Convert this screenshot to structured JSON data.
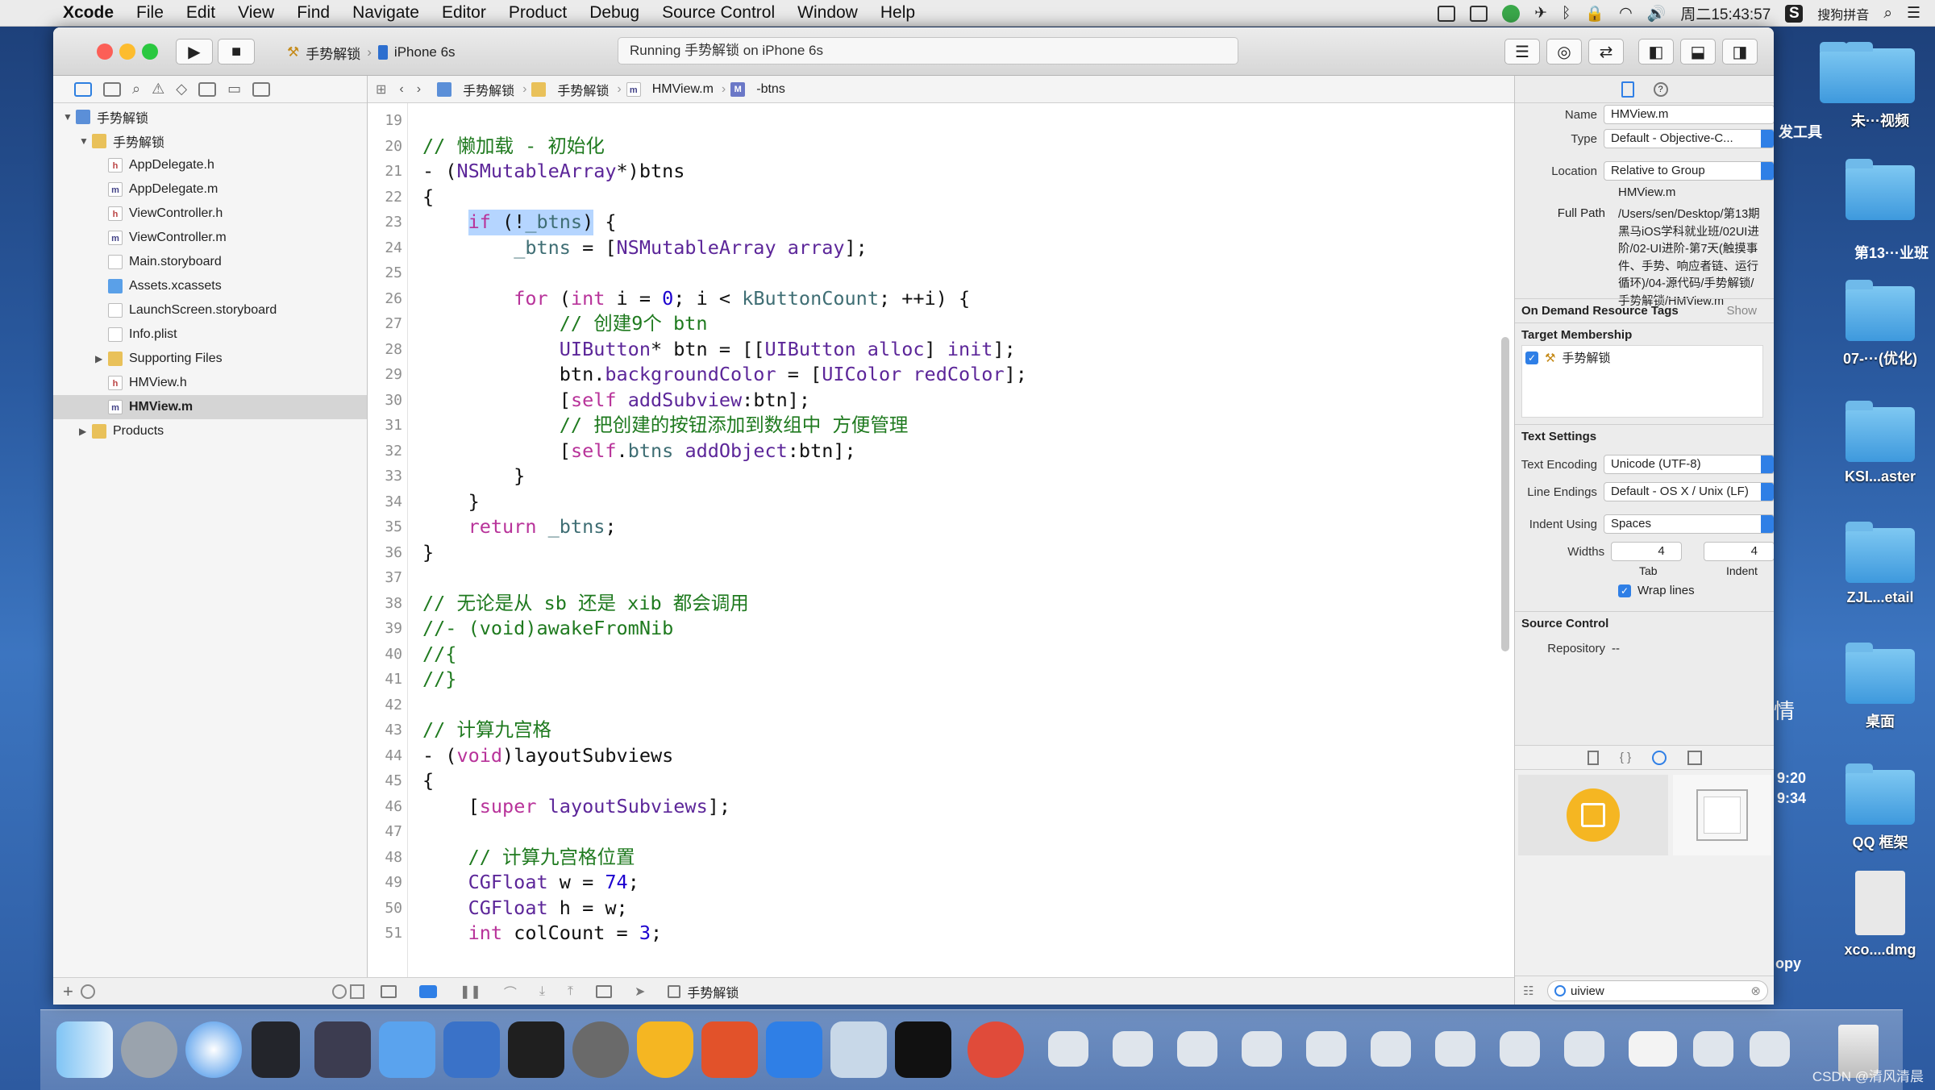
{
  "menubar": {
    "items": [
      "Xcode",
      "File",
      "Edit",
      "View",
      "Find",
      "Navigate",
      "Editor",
      "Product",
      "Debug",
      "Source Control",
      "Window",
      "Help"
    ],
    "clock": "周二15:43:57",
    "ime": "搜狗拼音"
  },
  "desktop": {
    "items": [
      "发工具",
      "未···视频",
      "第13···业班",
      "07-···(优化)",
      "KSI...aster",
      "ZJL...etail",
      "桌面",
      "QQ 框架",
      "xco....dmg"
    ],
    "side_texts": [
      "情",
      "9:20",
      "9:34",
      "opy"
    ]
  },
  "toolbar": {
    "scheme": "手势解锁",
    "device": "iPhone 6s",
    "activity": "Running 手势解锁 on iPhone 6s"
  },
  "jumpbar": {
    "items": [
      "手势解锁",
      "手势解锁",
      "HMView.m",
      "-btns"
    ]
  },
  "navigator": {
    "items": [
      {
        "label": "手势解锁",
        "icon": "project",
        "level": 0,
        "disc": "▼"
      },
      {
        "label": "手势解锁",
        "icon": "group",
        "level": 1,
        "disc": "▼"
      },
      {
        "label": "AppDelegate.h",
        "icon": "h",
        "level": 2,
        "disc": ""
      },
      {
        "label": "AppDelegate.m",
        "icon": "m",
        "level": 2,
        "disc": ""
      },
      {
        "label": "ViewController.h",
        "icon": "h",
        "level": 2,
        "disc": ""
      },
      {
        "label": "ViewController.m",
        "icon": "m",
        "level": 2,
        "disc": ""
      },
      {
        "label": "Main.storyboard",
        "icon": "sb",
        "level": 2,
        "disc": ""
      },
      {
        "label": "Assets.xcassets",
        "icon": "as",
        "level": 2,
        "disc": ""
      },
      {
        "label": "LaunchScreen.storyboard",
        "icon": "sb",
        "level": 2,
        "disc": ""
      },
      {
        "label": "Info.plist",
        "icon": "pl",
        "level": 2,
        "disc": ""
      },
      {
        "label": "Supporting Files",
        "icon": "group",
        "level": 2,
        "disc": "▶"
      },
      {
        "label": "HMView.h",
        "icon": "h",
        "level": 2,
        "disc": ""
      },
      {
        "label": "HMView.m",
        "icon": "m",
        "level": 2,
        "disc": "",
        "selected": true
      },
      {
        "label": "Products",
        "icon": "group",
        "level": 1,
        "disc": "▶"
      }
    ]
  },
  "editor": {
    "lines": [
      {
        "n": "19",
        "t": [
          [
            "",
            ""
          ]
        ]
      },
      {
        "n": "20",
        "t": [
          [
            "c",
            "// 懒加载 - 初始化"
          ]
        ]
      },
      {
        "n": "21",
        "t": [
          [
            "",
            "- ("
          ],
          [
            "t",
            "NSMutableArray"
          ],
          [
            "",
            "*)btns"
          ]
        ]
      },
      {
        "n": "22",
        "t": [
          [
            "",
            "{"
          ]
        ]
      },
      {
        "n": "23",
        "t": [
          [
            "",
            "    "
          ],
          [
            "hlk",
            "if"
          ],
          [
            "hl",
            " (!"
          ],
          [
            "hlp",
            "_btns"
          ],
          [
            "hl",
            ")"
          ],
          [
            "",
            " {"
          ]
        ]
      },
      {
        "n": "24",
        "t": [
          [
            "",
            "        "
          ],
          [
            "p",
            "_btns"
          ],
          [
            "",
            " = ["
          ],
          [
            "t",
            "NSMutableArray"
          ],
          [
            "",
            " "
          ],
          [
            "t",
            "array"
          ],
          [
            "",
            "];"
          ]
        ]
      },
      {
        "n": "25",
        "t": [
          [
            "",
            ""
          ]
        ]
      },
      {
        "n": "26",
        "t": [
          [
            "",
            "        "
          ],
          [
            "k",
            "for"
          ],
          [
            "",
            " ("
          ],
          [
            "k",
            "int"
          ],
          [
            "",
            " i = "
          ],
          [
            "n",
            "0"
          ],
          [
            "",
            "; i < "
          ],
          [
            "p",
            "kButtonCount"
          ],
          [
            "",
            "; ++i) {"
          ]
        ]
      },
      {
        "n": "27",
        "t": [
          [
            "c",
            "            // 创建9个 btn"
          ]
        ]
      },
      {
        "n": "28",
        "t": [
          [
            "",
            "            "
          ],
          [
            "t",
            "UIButton"
          ],
          [
            "",
            "* btn = [["
          ],
          [
            "t",
            "UIButton"
          ],
          [
            "",
            " "
          ],
          [
            "t",
            "alloc"
          ],
          [
            "",
            "] "
          ],
          [
            "t",
            "init"
          ],
          [
            "",
            "];"
          ]
        ]
      },
      {
        "n": "29",
        "t": [
          [
            "",
            "            btn."
          ],
          [
            "t",
            "backgroundColor"
          ],
          [
            "",
            " = ["
          ],
          [
            "t",
            "UIColor"
          ],
          [
            "",
            " "
          ],
          [
            "t",
            "redColor"
          ],
          [
            "",
            "];"
          ]
        ]
      },
      {
        "n": "30",
        "t": [
          [
            "",
            "            ["
          ],
          [
            "k",
            "self"
          ],
          [
            "",
            " "
          ],
          [
            "t",
            "addSubview"
          ],
          [
            "",
            ":btn];"
          ]
        ]
      },
      {
        "n": "31",
        "t": [
          [
            "c",
            "            // 把创建的按钮添加到数组中 方便管理"
          ]
        ]
      },
      {
        "n": "32",
        "t": [
          [
            "",
            "            ["
          ],
          [
            "k",
            "self"
          ],
          [
            "",
            "."
          ],
          [
            "p",
            "btns"
          ],
          [
            "",
            " "
          ],
          [
            "t",
            "addObject"
          ],
          [
            "",
            ":btn];"
          ]
        ]
      },
      {
        "n": "33",
        "t": [
          [
            "",
            "        }"
          ]
        ]
      },
      {
        "n": "34",
        "t": [
          [
            "",
            "    }"
          ]
        ]
      },
      {
        "n": "35",
        "t": [
          [
            "",
            "    "
          ],
          [
            "k",
            "return"
          ],
          [
            "",
            " "
          ],
          [
            "p",
            "_btns"
          ],
          [
            "",
            ";"
          ]
        ]
      },
      {
        "n": "36",
        "t": [
          [
            "",
            "}"
          ]
        ]
      },
      {
        "n": "37",
        "t": [
          [
            "",
            ""
          ]
        ]
      },
      {
        "n": "38",
        "t": [
          [
            "c",
            "// 无论是从 sb 还是 xib 都会调用"
          ]
        ]
      },
      {
        "n": "39",
        "t": [
          [
            "c",
            "//- (void)awakeFromNib"
          ]
        ]
      },
      {
        "n": "40",
        "t": [
          [
            "c",
            "//{"
          ]
        ]
      },
      {
        "n": "41",
        "t": [
          [
            "c",
            "//}"
          ]
        ]
      },
      {
        "n": "42",
        "t": [
          [
            "",
            ""
          ]
        ]
      },
      {
        "n": "43",
        "t": [
          [
            "c",
            "// 计算九宫格"
          ]
        ]
      },
      {
        "n": "44",
        "t": [
          [
            "",
            "- ("
          ],
          [
            "k",
            "void"
          ],
          [
            "",
            ")layoutSubviews"
          ]
        ]
      },
      {
        "n": "45",
        "t": [
          [
            "",
            "{"
          ]
        ]
      },
      {
        "n": "46",
        "t": [
          [
            "",
            "    ["
          ],
          [
            "k",
            "super"
          ],
          [
            "",
            " "
          ],
          [
            "t",
            "layoutSubviews"
          ],
          [
            "",
            "];"
          ]
        ]
      },
      {
        "n": "47",
        "t": [
          [
            "",
            ""
          ]
        ]
      },
      {
        "n": "48",
        "t": [
          [
            "c",
            "    // 计算九宫格位置"
          ]
        ]
      },
      {
        "n": "49",
        "t": [
          [
            "",
            "    "
          ],
          [
            "t",
            "CGFloat"
          ],
          [
            "",
            " w = "
          ],
          [
            "n",
            "74"
          ],
          [
            "",
            ";"
          ]
        ]
      },
      {
        "n": "50",
        "t": [
          [
            "",
            "    "
          ],
          [
            "t",
            "CGFloat"
          ],
          [
            "",
            " h = w;"
          ]
        ]
      },
      {
        "n": "51",
        "t": [
          [
            "",
            "    "
          ],
          [
            "k",
            "int"
          ],
          [
            "",
            " colCount = "
          ],
          [
            "n",
            "3"
          ],
          [
            "",
            ";"
          ]
        ]
      }
    ]
  },
  "debugbar": {
    "target": "手势解锁"
  },
  "inspector": {
    "name_label": "Name",
    "name_value": "HMView.m",
    "type_label": "Type",
    "type_value": "Default - Objective-C...",
    "location_label": "Location",
    "location_value": "Relative to Group",
    "location_file": "HMView.m",
    "fullpath_label": "Full Path",
    "fullpath_value": "/Users/sen/Desktop/第13期黑马iOS学科就业班/02UI进阶/02-UI进阶-第7天(触摸事件、手势、响应者链、运行循环)/04-源代码/手势解锁/手势解锁/HMView.m",
    "on_demand": "On Demand Resource Tags",
    "show": "Show",
    "target_membership": "Target Membership",
    "target_name": "手势解锁",
    "text_settings": "Text Settings",
    "encoding_label": "Text Encoding",
    "encoding_value": "Unicode (UTF-8)",
    "line_endings_label": "Line Endings",
    "line_endings_value": "Default - OS X / Unix (LF)",
    "indent_using_label": "Indent Using",
    "indent_using_value": "Spaces",
    "widths_label": "Widths",
    "tab_width": "4",
    "indent_width": "4",
    "tab_label": "Tab",
    "indent_label": "Indent",
    "wrap_lines": "Wrap lines",
    "source_control": "Source Control",
    "repository_label": "Repository",
    "repository_value": "--",
    "filter_value": "uiview"
  },
  "watermark": "CSDN @清风清晨"
}
